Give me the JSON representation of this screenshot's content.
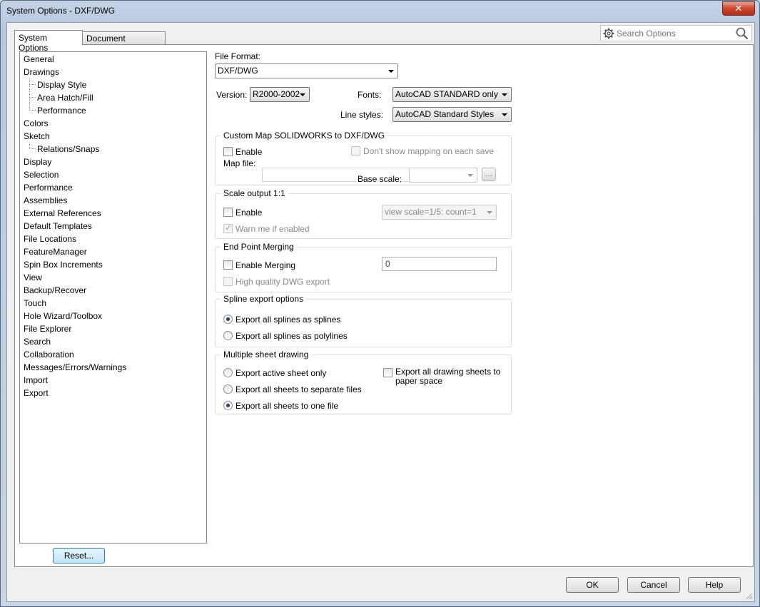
{
  "window": {
    "title": "System Options - DXF/DWG",
    "close": "✕"
  },
  "tabs": {
    "system_options": "System Options",
    "document_properties": "Document Properties"
  },
  "search": {
    "placeholder": "Search Options"
  },
  "tree": [
    {
      "label": "General",
      "child": false
    },
    {
      "label": "Drawings",
      "child": false
    },
    {
      "label": "Display Style",
      "child": true
    },
    {
      "label": "Area Hatch/Fill",
      "child": true
    },
    {
      "label": "Performance",
      "child": true
    },
    {
      "label": "Colors",
      "child": false
    },
    {
      "label": "Sketch",
      "child": false
    },
    {
      "label": "Relations/Snaps",
      "child": true
    },
    {
      "label": "Display",
      "child": false
    },
    {
      "label": "Selection",
      "child": false
    },
    {
      "label": "Performance",
      "child": false
    },
    {
      "label": "Assemblies",
      "child": false
    },
    {
      "label": "External References",
      "child": false
    },
    {
      "label": "Default Templates",
      "child": false
    },
    {
      "label": "File Locations",
      "child": false
    },
    {
      "label": "FeatureManager",
      "child": false
    },
    {
      "label": "Spin Box Increments",
      "child": false
    },
    {
      "label": "View",
      "child": false
    },
    {
      "label": "Backup/Recover",
      "child": false
    },
    {
      "label": "Touch",
      "child": false
    },
    {
      "label": "Hole Wizard/Toolbox",
      "child": false
    },
    {
      "label": "File Explorer",
      "child": false
    },
    {
      "label": "Search",
      "child": false
    },
    {
      "label": "Collaboration",
      "child": false
    },
    {
      "label": "Messages/Errors/Warnings",
      "child": false
    },
    {
      "label": "Import",
      "child": false
    },
    {
      "label": "Export",
      "child": false
    }
  ],
  "reset_button": "Reset...",
  "file_format": {
    "label": "File Format:",
    "value": "DXF/DWG"
  },
  "version": {
    "label": "Version:",
    "value": "R2000-2002"
  },
  "fonts": {
    "label": "Fonts:",
    "value": "AutoCAD STANDARD only"
  },
  "line_styles": {
    "label": "Line styles:",
    "value": "AutoCAD Standard Styles"
  },
  "custom_map": {
    "title": "Custom Map SOLIDWORKS to DXF/DWG",
    "enable": "Enable",
    "dont_show": "Don't show mapping on each save",
    "map_file": "Map file:",
    "base_scale": "Base scale:",
    "browse": "..."
  },
  "scale_output": {
    "title": "Scale output 1:1",
    "enable": "Enable",
    "view_scale": "view scale=1/5: count=1",
    "warn": "Warn me if enabled"
  },
  "end_point": {
    "title": "End Point Merging",
    "enable": "Enable Merging",
    "value": "0",
    "high_quality": "High quality DWG export"
  },
  "spline": {
    "title": "Spline export options",
    "as_splines": "Export all splines as splines",
    "as_polylines": "Export all splines as polylines"
  },
  "multi_sheet": {
    "title": "Multiple sheet drawing",
    "active_only": "Export active sheet only",
    "separate_files": "Export all sheets to separate files",
    "one_file": "Export all sheets to one file",
    "paper_space": "Export all drawing sheets to paper space"
  },
  "footer": {
    "ok": "OK",
    "cancel": "Cancel",
    "help": "Help"
  }
}
